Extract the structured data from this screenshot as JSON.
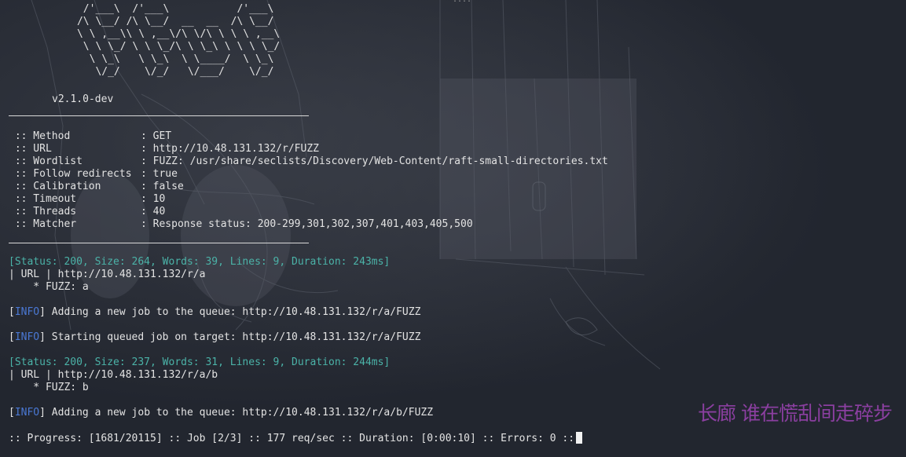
{
  "banner": {
    "ascii": "       /'___\\  /'___\\           /'___\\\n      /\\ \\__/ /\\ \\__/  __  __  /\\ \\__/\n      \\ \\ ,__\\\\ \\ ,__\\/\\ \\/\\ \\ \\ \\ ,__\\\n       \\ \\ \\_/ \\ \\ \\_/\\ \\ \\_\\ \\ \\ \\ \\_/\n        \\ \\_\\   \\ \\_\\  \\ \\____/  \\ \\_\\\n         \\/_/    \\/_/   \\/___/    \\/_/",
    "version": "v2.1.0-dev"
  },
  "config": [
    {
      "key": " :: Method",
      "value": ": GET"
    },
    {
      "key": " :: URL",
      "value": ": http://10.48.131.132/r/FUZZ"
    },
    {
      "key": " :: Wordlist",
      "value": ": FUZZ: /usr/share/seclists/Discovery/Web-Content/raft-small-directories.txt"
    },
    {
      "key": " :: Follow redirects",
      "value": ": true"
    },
    {
      "key": " :: Calibration",
      "value": ": false"
    },
    {
      "key": " :: Timeout",
      "value": ": 10"
    },
    {
      "key": " :: Threads",
      "value": ": 40"
    },
    {
      "key": " :: Matcher",
      "value": ": Response status: 200-299,301,302,307,401,403,405,500"
    }
  ],
  "results": {
    "r1_status": "[Status: 200, Size: 264, Words: 39, Lines: 9, Duration: 243ms]",
    "r1_url": "| URL | http://10.48.131.132/r/a",
    "r1_fuzz": "    * FUZZ: a",
    "info1_tag": "INFO",
    "info1_text": " Adding a new job to the queue: http://10.48.131.132/r/a/FUZZ",
    "info2_tag": "INFO",
    "info2_text": " Starting queued job on target: http://10.48.131.132/r/a/FUZZ",
    "r2_status": "[Status: 200, Size: 237, Words: 31, Lines: 9, Duration: 244ms]",
    "r2_url": "| URL | http://10.48.131.132/r/a/b",
    "r2_fuzz": "    * FUZZ: b",
    "info3_tag": "INFO",
    "info3_text": " Adding a new job to the queue: http://10.48.131.132/r/a/b/FUZZ"
  },
  "progress": ":: Progress: [1681/20115] :: Job [2/3] :: 177 req/sec :: Duration: [0:00:10] :: Errors: 0 ::",
  "watermark": "长廊 谁在慌乱间走碎步",
  "top_dots": "....",
  "colors": {
    "background": "#22262f",
    "text": "#e3e3e3",
    "status": "#4bb3a8",
    "info": "#4a78d4",
    "watermark": "#8b3fa0"
  }
}
